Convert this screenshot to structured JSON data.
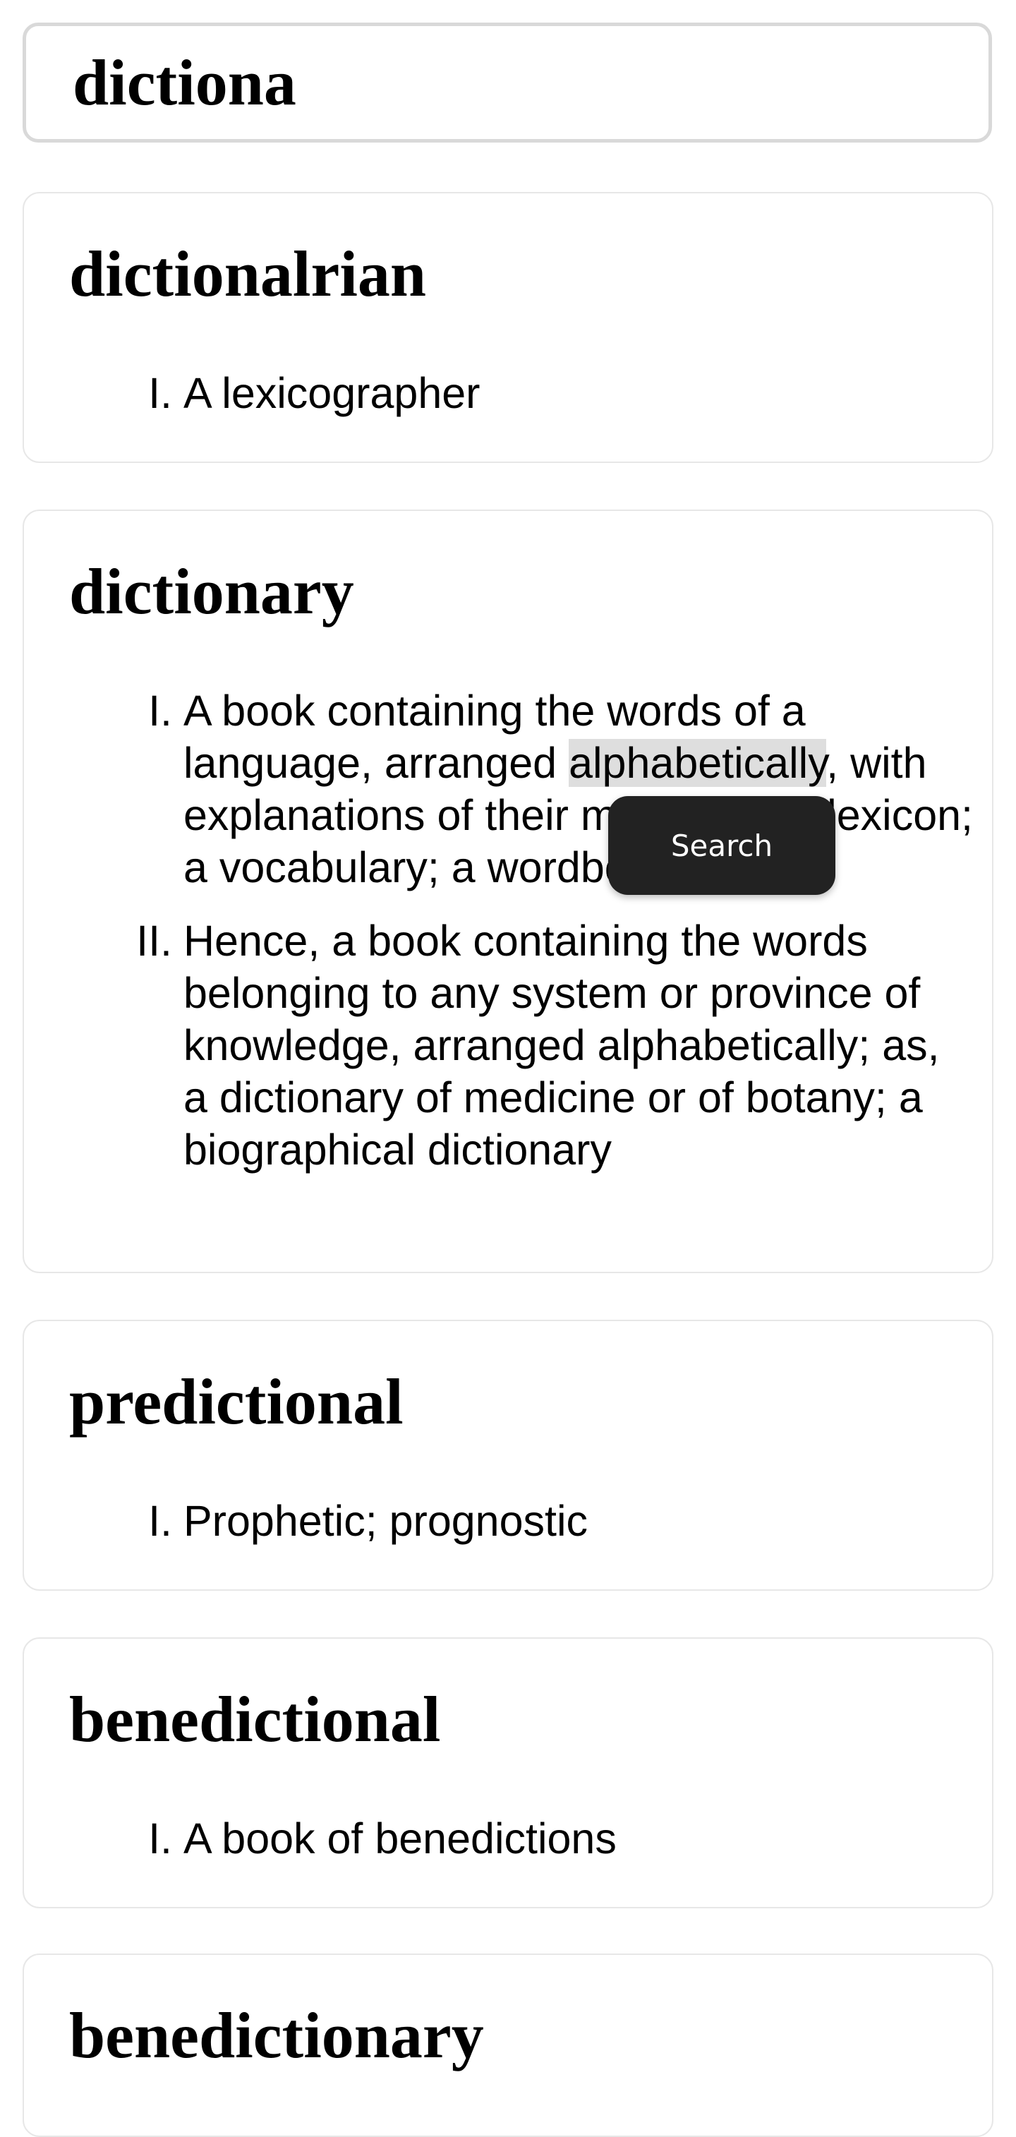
{
  "search": {
    "value": "dictiona"
  },
  "results": [
    {
      "headword": "dictionalrian",
      "definitions": [
        {
          "numeral": "I.",
          "text": "A lexicographer"
        }
      ]
    },
    {
      "headword": "dictionary",
      "definitions": [
        {
          "numeral": "I.",
          "before": "A book containing the words of a language, arranged ",
          "highlight": "alphabetically",
          "after": ", with explanations of their meanings; a lexicon; a vocabulary; a wordbook"
        },
        {
          "numeral": "II.",
          "text": "Hence, a book containing the words belonging to any system or province of knowledge, arranged alphabetically; as, a dictionary of medicine or of botany; a biographical dictionary"
        }
      ]
    },
    {
      "headword": "predictional",
      "definitions": [
        {
          "numeral": "I.",
          "text": "Prophetic; prognostic"
        }
      ]
    },
    {
      "headword": "benedictional",
      "definitions": [
        {
          "numeral": "I.",
          "text": "A book of benedictions"
        }
      ]
    },
    {
      "headword": "benedictionary"
    }
  ],
  "selection_popup": {
    "label": "Search"
  }
}
